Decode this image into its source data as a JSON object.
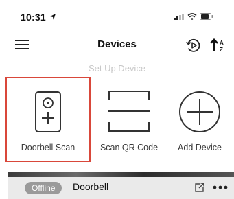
{
  "status_bar": {
    "time": "10:31",
    "icons": [
      "location-arrow-icon",
      "signal-icon",
      "wifi-icon",
      "battery-icon"
    ]
  },
  "header": {
    "title": "Devices",
    "menu_icon": "hamburger-menu-icon",
    "history_icon": "playback-icon",
    "sort_icon": "sort-az-icon"
  },
  "setup": {
    "subtitle": "Set Up Device",
    "options": [
      {
        "label": "Doorbell Scan",
        "icon": "doorbell-icon",
        "highlighted": true,
        "highlight_color": "#d9473a"
      },
      {
        "label": "Scan QR Code",
        "icon": "qr-scan-icon",
        "highlighted": false
      },
      {
        "label": "Add Device",
        "icon": "plus-circle-icon",
        "highlighted": false
      }
    ]
  },
  "device": {
    "status": "Offline",
    "name": "Doorbell",
    "share_icon": "share-icon",
    "more_icon": "more-dots-icon"
  }
}
